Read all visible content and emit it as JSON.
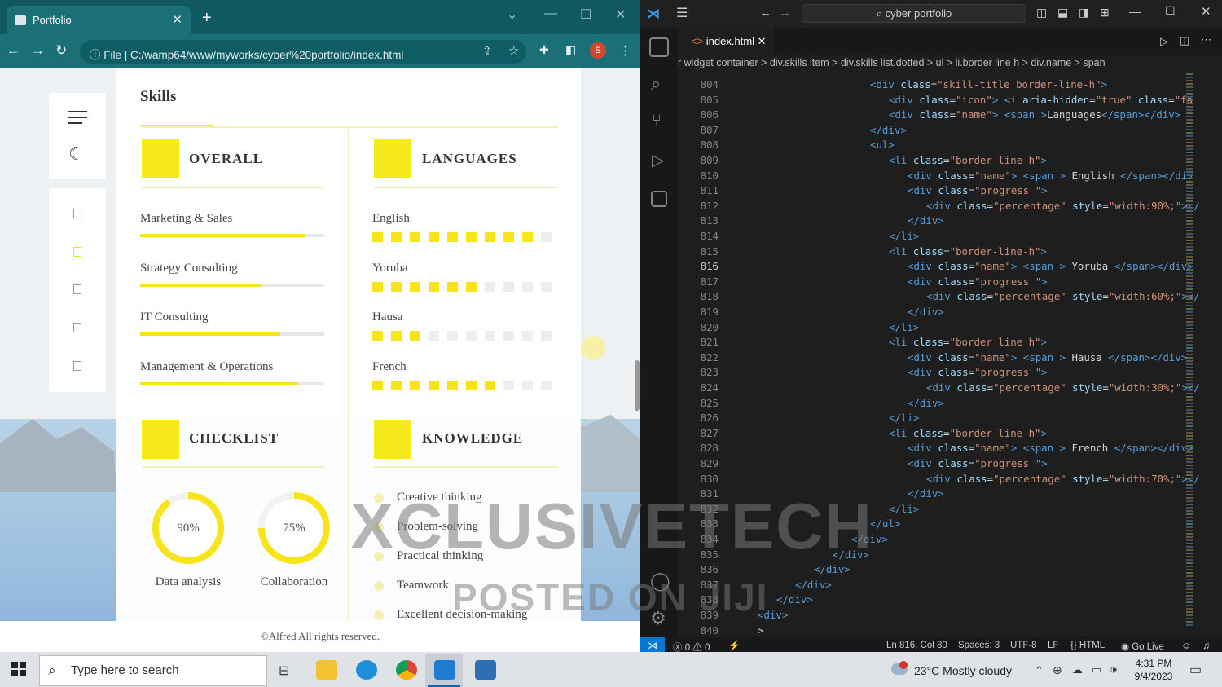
{
  "browser": {
    "tab_title": "Portfolio",
    "url_prefix": "File",
    "url": "C:/wamp64/www/myworks/cyber%20portfolio/index.html",
    "profile_initial": "S"
  },
  "site": {
    "skills_title": "Skills",
    "overall": {
      "title": "OVERALL",
      "items": [
        {
          "label": "Marketing & Sales",
          "value": 0.9
        },
        {
          "label": "Strategy Consulting",
          "value": 0.66
        },
        {
          "label": "IT Consulting",
          "value": 0.76
        },
        {
          "label": "Management & Operations",
          "value": 0.86
        }
      ]
    },
    "languages": {
      "title": "LANGUAGES",
      "items": [
        {
          "label": "English",
          "filled": 9,
          "total": 10
        },
        {
          "label": "Yoruba",
          "filled": 6,
          "total": 10
        },
        {
          "label": "Hausa",
          "filled": 3,
          "total": 10
        },
        {
          "label": "French",
          "filled": 7,
          "total": 10
        }
      ]
    },
    "checklist": {
      "title": "CHECKLIST",
      "rings": [
        {
          "label": "Data analysis",
          "value": "90%",
          "pct": 90
        },
        {
          "label": "Collaboration",
          "value": "75%",
          "pct": 75
        }
      ]
    },
    "knowledge": {
      "title": "KNOWLEDGE",
      "items": [
        "Creative thinking",
        "Problem-solving",
        "Practical thinking",
        "Teamwork",
        "Excellent decision-making"
      ]
    },
    "footer": "©Alfred All rights reserved."
  },
  "vscode": {
    "search": "cyber portfolio",
    "tab": "index.html",
    "breadcrumbs": "r widget container > div.skills item > div.skills list.dotted > ul > li.border line h > div.name > span",
    "lines": [
      {
        "n": "804",
        "code": [
          [
            "tg",
            "<div "
          ],
          [
            "at",
            "class"
          ],
          [
            "tx",
            "="
          ],
          [
            "st",
            "\"skill-title border-line-h\""
          ],
          [
            "tg",
            ">"
          ]
        ],
        "ind": 3
      },
      {
        "n": "805",
        "code": [
          [
            "tg",
            "<div "
          ],
          [
            "at",
            "class"
          ],
          [
            "tx",
            "="
          ],
          [
            "st",
            "\"icon\""
          ],
          [
            "tg",
            "> <i "
          ],
          [
            "at",
            "aria-hidden"
          ],
          [
            "tx",
            "="
          ],
          [
            "st",
            "\"true\""
          ],
          [
            "at",
            " class"
          ],
          [
            "tx",
            "="
          ],
          [
            "st",
            "\"fa"
          ]
        ],
        "ind": 4
      },
      {
        "n": "806",
        "code": [
          [
            "tg",
            "<div "
          ],
          [
            "at",
            "class"
          ],
          [
            "tx",
            "="
          ],
          [
            "st",
            "\"name\""
          ],
          [
            "tg",
            "> <span >"
          ],
          [
            "tx",
            "Languages"
          ],
          [
            "tg",
            "</span></div>"
          ]
        ],
        "ind": 4
      },
      {
        "n": "807",
        "code": [
          [
            "tg",
            "</div>"
          ]
        ],
        "ind": 3
      },
      {
        "n": "808",
        "code": [
          [
            "tg",
            "<ul>"
          ]
        ],
        "ind": 3
      },
      {
        "n": "809",
        "code": [
          [
            "tg",
            "<li "
          ],
          [
            "at",
            "class"
          ],
          [
            "tx",
            "="
          ],
          [
            "st",
            "\"border-line-h\""
          ],
          [
            "tg",
            ">"
          ]
        ],
        "ind": 4
      },
      {
        "n": "810",
        "code": [
          [
            "tg",
            "<div "
          ],
          [
            "at",
            "class"
          ],
          [
            "tx",
            "="
          ],
          [
            "st",
            "\"name\""
          ],
          [
            "tg",
            "> <span > "
          ],
          [
            "tx",
            "English "
          ],
          [
            "tg",
            "</span></div"
          ]
        ],
        "ind": 5
      },
      {
        "n": "811",
        "code": [
          [
            "tg",
            "<div "
          ],
          [
            "at",
            "class"
          ],
          [
            "tx",
            "="
          ],
          [
            "st",
            "\"progress \""
          ],
          [
            "tg",
            ">"
          ]
        ],
        "ind": 5
      },
      {
        "n": "812",
        "code": [
          [
            "tg",
            "<div "
          ],
          [
            "at",
            "class"
          ],
          [
            "tx",
            "="
          ],
          [
            "st",
            "\"percentage\""
          ],
          [
            "at",
            " style"
          ],
          [
            "tx",
            "="
          ],
          [
            "st",
            "\"width:90%;\""
          ],
          [
            "tg",
            "></"
          ]
        ],
        "ind": 6
      },
      {
        "n": "813",
        "code": [
          [
            "tg",
            "</div>"
          ]
        ],
        "ind": 5
      },
      {
        "n": "814",
        "code": [
          [
            "tg",
            "</li>"
          ]
        ],
        "ind": 4
      },
      {
        "n": "815",
        "code": [
          [
            "tg",
            "<li "
          ],
          [
            "at",
            "class"
          ],
          [
            "tx",
            "="
          ],
          [
            "st",
            "\"border-line-h\""
          ],
          [
            "tg",
            ">"
          ]
        ],
        "ind": 4
      },
      {
        "n": "816",
        "code": [
          [
            "tg",
            "<div "
          ],
          [
            "at",
            "class"
          ],
          [
            "tx",
            "="
          ],
          [
            "st",
            "\"name\""
          ],
          [
            "tg",
            "> <span > "
          ],
          [
            "tx",
            "Yoruba "
          ],
          [
            "tg",
            "</span></div>"
          ]
        ],
        "ind": 5,
        "cur": true
      },
      {
        "n": "817",
        "code": [
          [
            "tg",
            "<div "
          ],
          [
            "at",
            "class"
          ],
          [
            "tx",
            "="
          ],
          [
            "st",
            "\"progress \""
          ],
          [
            "tg",
            ">"
          ]
        ],
        "ind": 5
      },
      {
        "n": "818",
        "code": [
          [
            "tg",
            "<div "
          ],
          [
            "at",
            "class"
          ],
          [
            "tx",
            "="
          ],
          [
            "st",
            "\"percentage\""
          ],
          [
            "at",
            " style"
          ],
          [
            "tx",
            "="
          ],
          [
            "st",
            "\"width:60%;\""
          ],
          [
            "tg",
            "></"
          ]
        ],
        "ind": 6
      },
      {
        "n": "819",
        "code": [
          [
            "tg",
            "</div>"
          ]
        ],
        "ind": 5
      },
      {
        "n": "820",
        "code": [
          [
            "tg",
            "</li>"
          ]
        ],
        "ind": 4
      },
      {
        "n": "821",
        "code": [
          [
            "tg",
            "<li "
          ],
          [
            "at",
            "class"
          ],
          [
            "tx",
            "="
          ],
          [
            "st",
            "\"border line h\""
          ],
          [
            "tg",
            ">"
          ]
        ],
        "ind": 4
      },
      {
        "n": "822",
        "code": [
          [
            "tg",
            "<div "
          ],
          [
            "at",
            "class"
          ],
          [
            "tx",
            "="
          ],
          [
            "st",
            "\"name\""
          ],
          [
            "tg",
            "> <span > "
          ],
          [
            "tx",
            "Hausa "
          ],
          [
            "tg",
            "</span></div>"
          ]
        ],
        "ind": 5
      },
      {
        "n": "823",
        "code": [
          [
            "tg",
            "<div "
          ],
          [
            "at",
            "class"
          ],
          [
            "tx",
            "="
          ],
          [
            "st",
            "\"progress \""
          ],
          [
            "tg",
            ">"
          ]
        ],
        "ind": 5
      },
      {
        "n": "824",
        "code": [
          [
            "tg",
            "<div "
          ],
          [
            "at",
            "class"
          ],
          [
            "tx",
            "="
          ],
          [
            "st",
            "\"percentage\""
          ],
          [
            "at",
            " style"
          ],
          [
            "tx",
            "="
          ],
          [
            "st",
            "\"width:30%;\""
          ],
          [
            "tg",
            "></"
          ]
        ],
        "ind": 6
      },
      {
        "n": "825",
        "code": [
          [
            "tg",
            "</div>"
          ]
        ],
        "ind": 5
      },
      {
        "n": "826",
        "code": [
          [
            "tg",
            "</li>"
          ]
        ],
        "ind": 4
      },
      {
        "n": "827",
        "code": [
          [
            "tg",
            "<li "
          ],
          [
            "at",
            "class"
          ],
          [
            "tx",
            "="
          ],
          [
            "st",
            "\"border-line-h\""
          ],
          [
            "tg",
            ">"
          ]
        ],
        "ind": 4
      },
      {
        "n": "828",
        "code": [
          [
            "tg",
            "<div "
          ],
          [
            "at",
            "class"
          ],
          [
            "tx",
            "="
          ],
          [
            "st",
            "\"name\""
          ],
          [
            "tg",
            "> <span > "
          ],
          [
            "tx",
            "French "
          ],
          [
            "tg",
            "</span></div>"
          ]
        ],
        "ind": 5
      },
      {
        "n": "829",
        "code": [
          [
            "tg",
            "<div "
          ],
          [
            "at",
            "class"
          ],
          [
            "tx",
            "="
          ],
          [
            "st",
            "\"progress \""
          ],
          [
            "tg",
            ">"
          ]
        ],
        "ind": 5
      },
      {
        "n": "830",
        "code": [
          [
            "tg",
            "<div "
          ],
          [
            "at",
            "class"
          ],
          [
            "tx",
            "="
          ],
          [
            "st",
            "\"percentage\""
          ],
          [
            "at",
            " style"
          ],
          [
            "tx",
            "="
          ],
          [
            "st",
            "\"width:70%;\""
          ],
          [
            "tg",
            "></"
          ]
        ],
        "ind": 6
      },
      {
        "n": "831",
        "code": [
          [
            "tg",
            "</div>"
          ]
        ],
        "ind": 5
      },
      {
        "n": "832",
        "code": [
          [
            "tg",
            "</li>"
          ]
        ],
        "ind": 4
      },
      {
        "n": "833",
        "code": [
          [
            "tg",
            "</ul>"
          ]
        ],
        "ind": 3
      },
      {
        "n": "834",
        "code": [
          [
            "tg",
            "</div>"
          ]
        ],
        "ind": 2
      },
      {
        "n": "835",
        "code": [
          [
            "tg",
            "</div>"
          ]
        ],
        "ind": 1
      },
      {
        "n": "836",
        "code": [
          [
            "tg",
            "</div>"
          ]
        ],
        "ind": 0
      },
      {
        "n": "837",
        "code": [
          [
            "tg",
            "</div>"
          ]
        ],
        "ind": -1
      },
      {
        "n": "838",
        "code": [
          [
            "tg",
            "</div>"
          ]
        ],
        "ind": -2
      },
      {
        "n": "839",
        "code": [
          [
            "tg",
            "<div>"
          ]
        ],
        "ind": -3
      },
      {
        "n": "840",
        "code": [
          [
            "tx",
            ">"
          ]
        ],
        "ind": -3
      }
    ],
    "status": {
      "errors": "0",
      "warnings": "0",
      "position": "Ln 816, Col 80",
      "spaces": "Spaces: 3",
      "encoding": "UTF-8",
      "eol": "LF",
      "language": "HTML",
      "golive": "Go Live"
    }
  },
  "taskbar": {
    "search_placeholder": "Type here to search",
    "weather_temp": "23°C",
    "weather_text": "Mostly cloudy",
    "time": "4:31 PM",
    "date": "9/4/2023"
  },
  "watermark": {
    "line1": "XCLUSIVETECH",
    "line2": "POSTED ON JIJI"
  },
  "colors": {
    "accent_yellow": "#f7e41a",
    "chrome_teal": "#1b6f77",
    "vscode_blue": "#0078d4"
  }
}
